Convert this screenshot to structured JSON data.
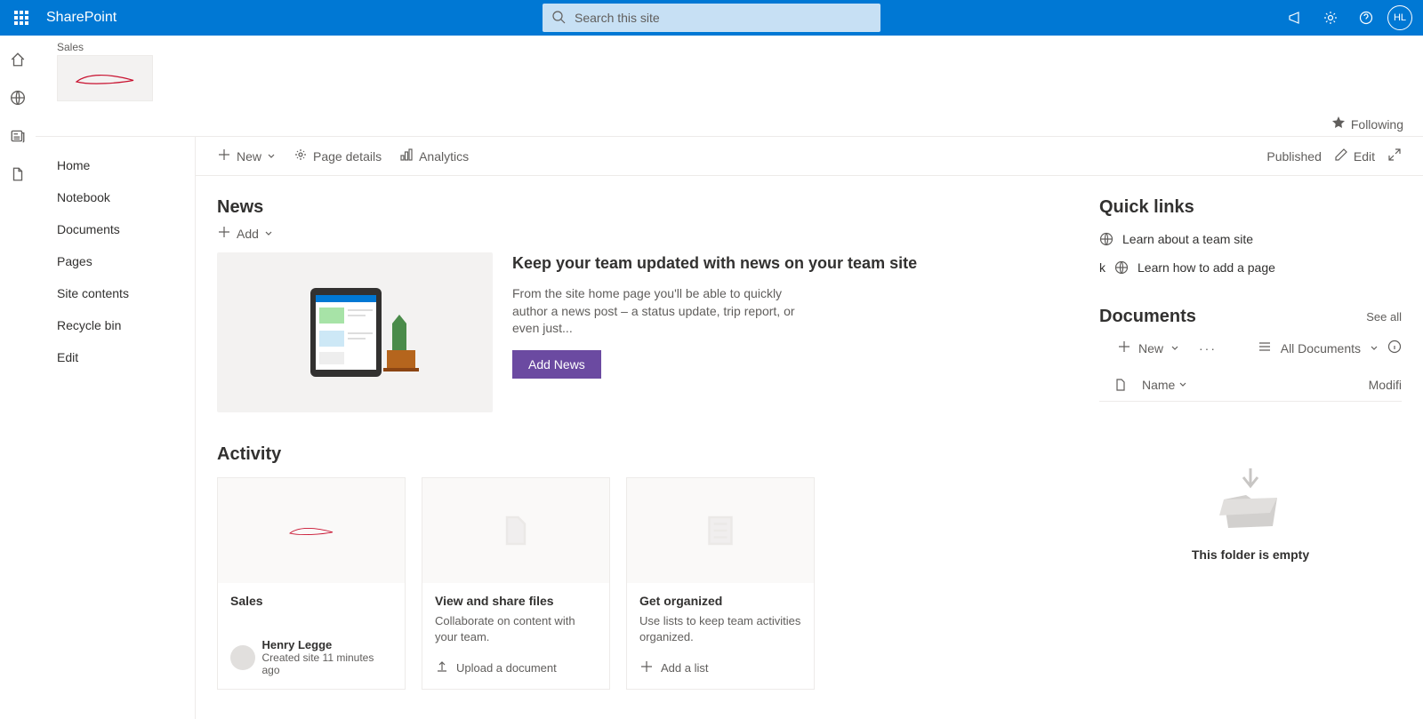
{
  "app": {
    "name": "SharePoint"
  },
  "search": {
    "placeholder": "Search this site"
  },
  "avatar": {
    "initials": "HL"
  },
  "site": {
    "label": "Sales"
  },
  "follow": {
    "label": "Following"
  },
  "leftnav": {
    "items": [
      "Home",
      "Notebook",
      "Documents",
      "Pages",
      "Site contents",
      "Recycle bin",
      "Edit"
    ]
  },
  "cmdbar": {
    "new": "New",
    "pageDetails": "Page details",
    "analytics": "Analytics",
    "published": "Published",
    "edit": "Edit"
  },
  "news": {
    "title": "News",
    "add": "Add",
    "heroTitle": "Keep your team updated with news on your team site",
    "heroDesc": "From the site home page you'll be able to quickly author a news post – a status update, trip report, or even just...",
    "btn": "Add News"
  },
  "activity": {
    "title": "Activity",
    "cards": [
      {
        "title": "Sales",
        "desc": "",
        "personaName": "Henry Legge",
        "personaSub": "Created site 11 minutes ago"
      },
      {
        "title": "View and share files",
        "desc": "Collaborate on content with your team.",
        "actionLabel": "Upload a document"
      },
      {
        "title": "Get organized",
        "desc": "Use lists to keep team activities organized.",
        "actionLabel": "Add a list"
      }
    ]
  },
  "quicklinks": {
    "title": "Quick links",
    "items": [
      "Learn about a team site",
      "Learn how to add a page"
    ]
  },
  "docs": {
    "title": "Documents",
    "seeAll": "See all",
    "new": "New",
    "allDocs": "All Documents",
    "colName": "Name",
    "colMod": "Modifi",
    "empty": "This folder is empty"
  }
}
